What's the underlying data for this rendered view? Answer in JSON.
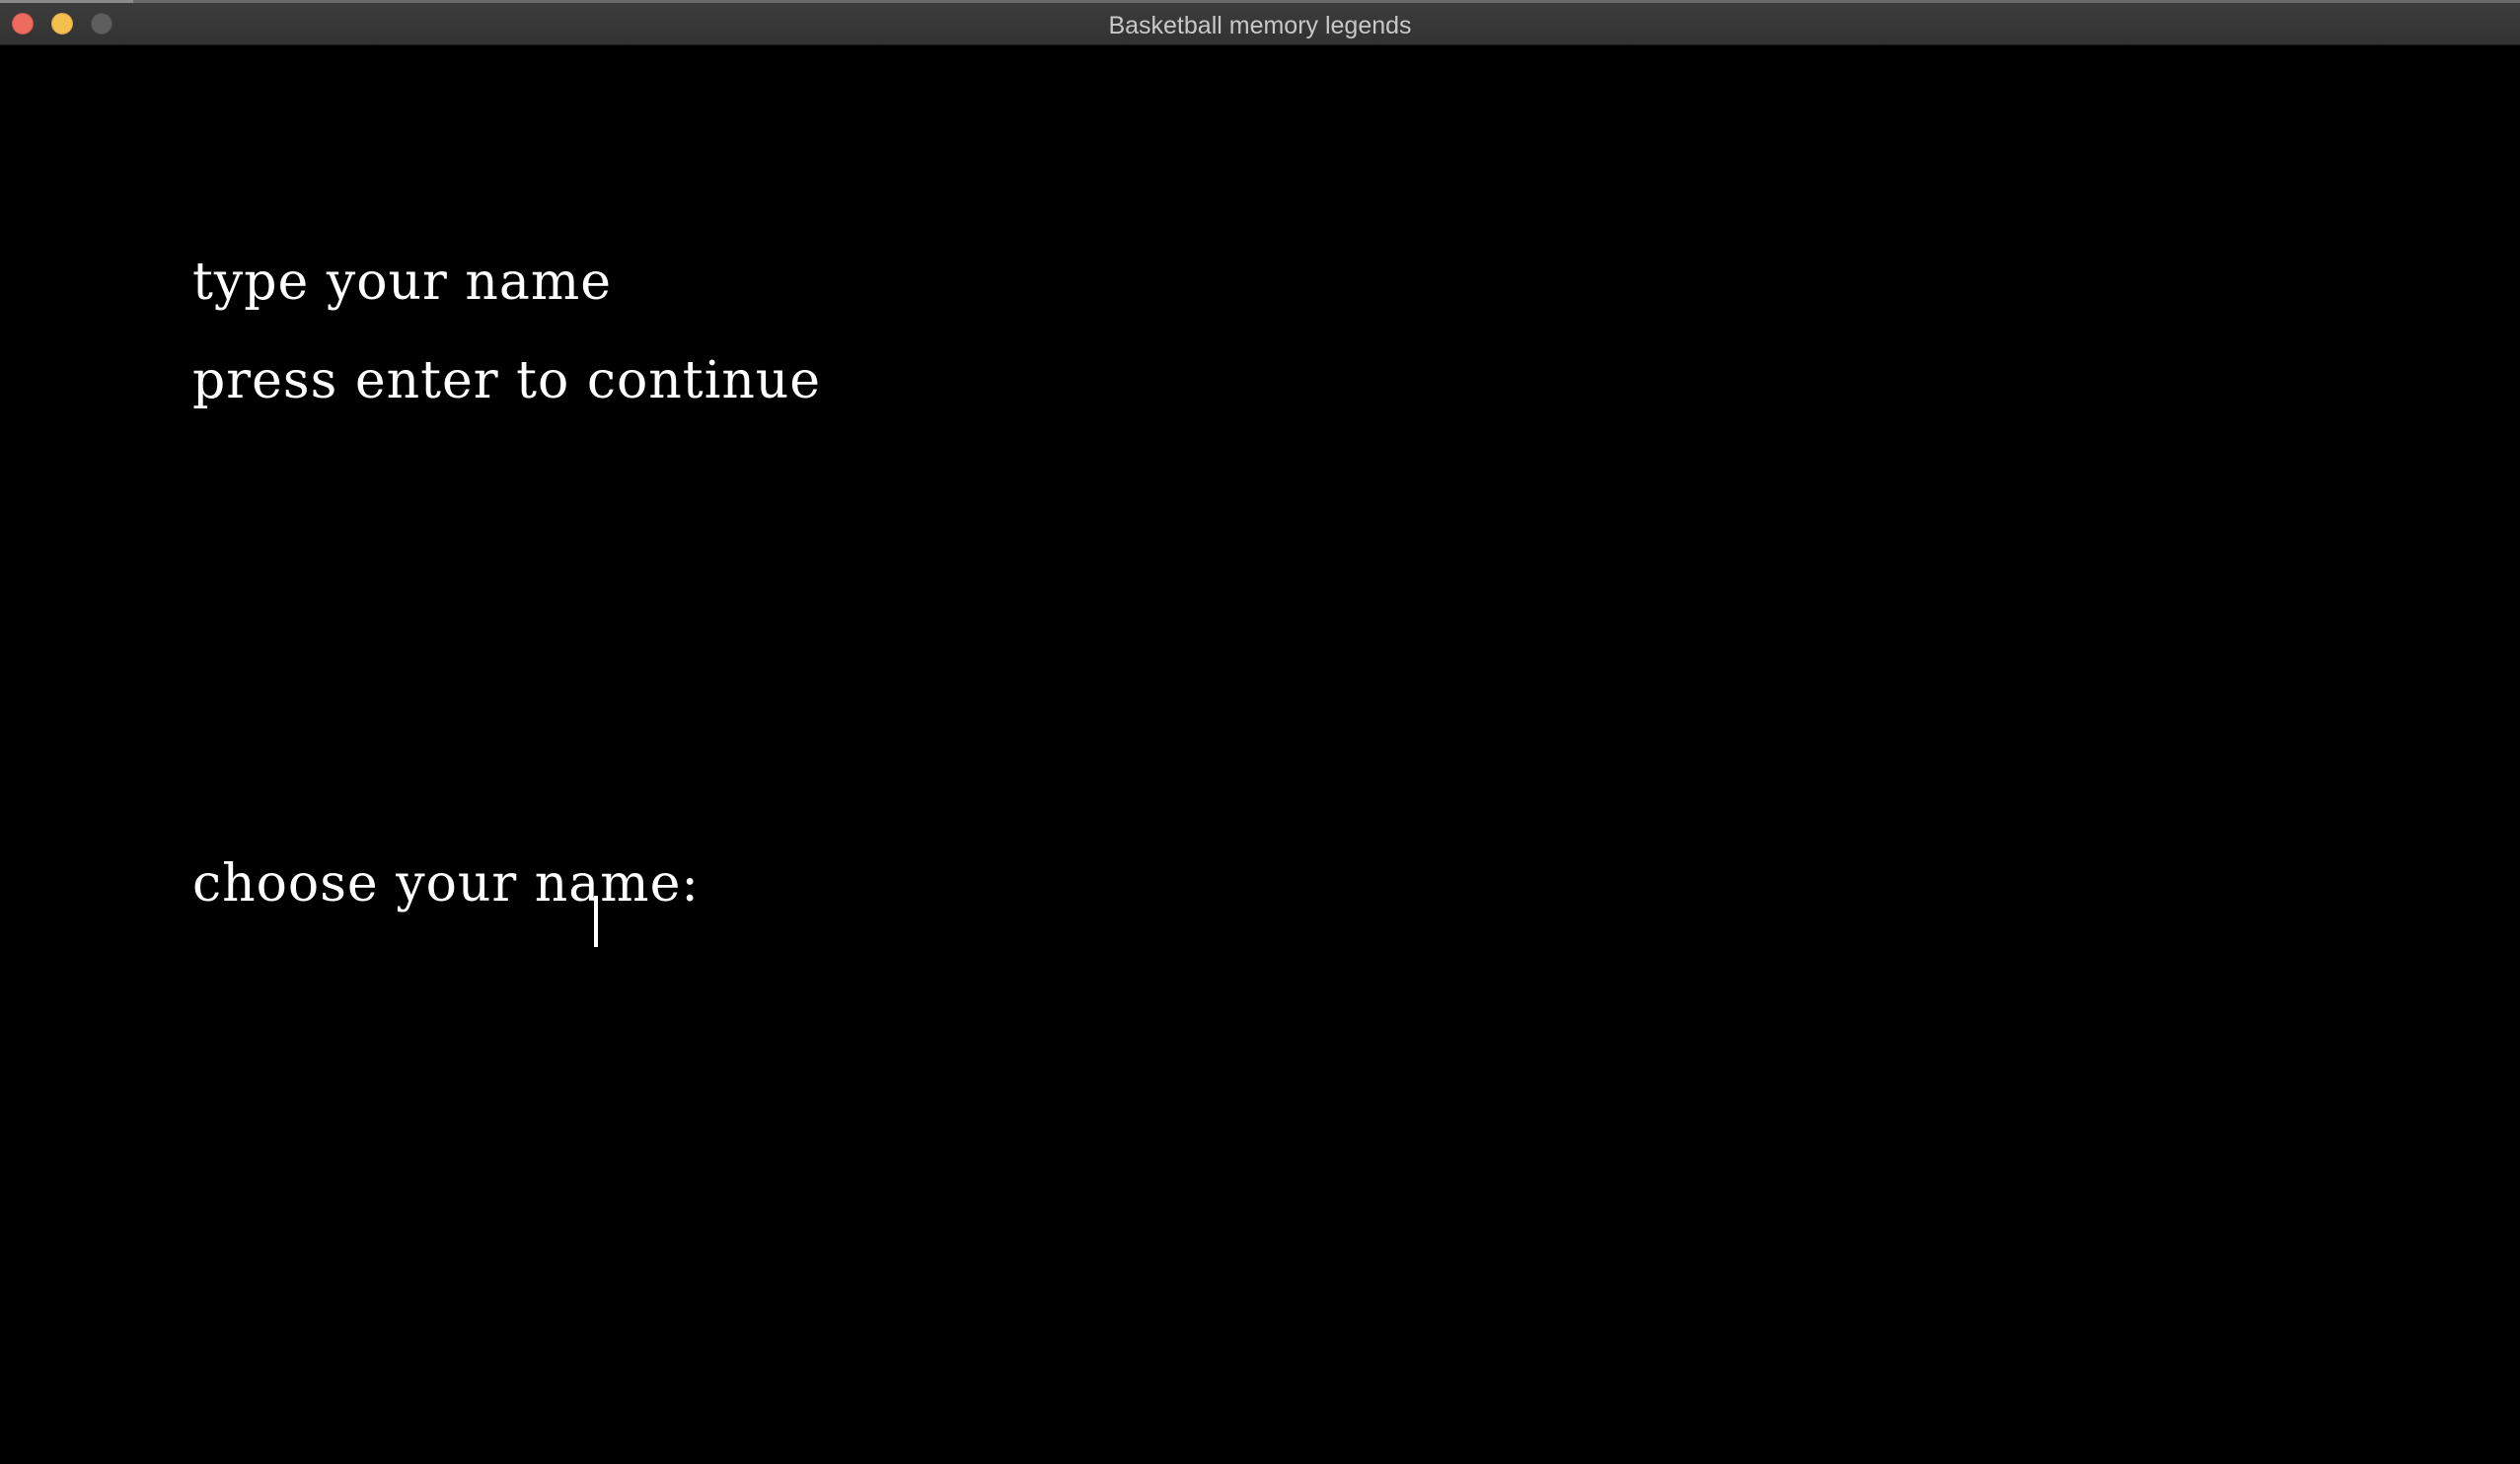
{
  "window": {
    "title": "Basketball memory legends"
  },
  "screen": {
    "instruction_line1": "type your name",
    "instruction_line2": "press enter to continue",
    "prompt_label": "choose your name:",
    "name_value": ""
  },
  "colors": {
    "background": "#000000",
    "text": "#ffffff",
    "titlebar": "#383838",
    "close": "#ed6a5e",
    "minimize": "#f5bf4f",
    "zoom": "#5e5e5e"
  }
}
